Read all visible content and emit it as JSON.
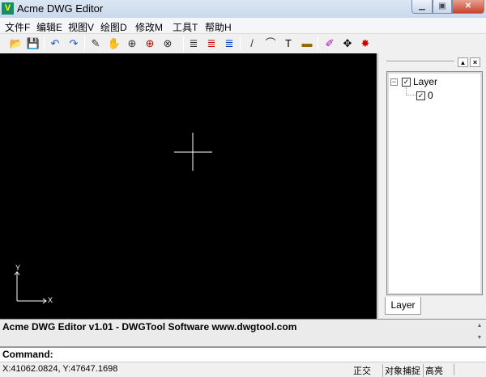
{
  "title": "Acme DWG Editor",
  "app_icon": "V",
  "menu": [
    "文件F",
    "编辑E",
    "视图V",
    "绘图D",
    "修改M",
    "工具T",
    "帮助H"
  ],
  "toolbar": [
    {
      "name": "open-icon",
      "glyph": "📂"
    },
    {
      "name": "save-icon",
      "glyph": "💾"
    },
    {
      "name": "undo-icon",
      "glyph": "↶"
    },
    {
      "name": "redo-icon",
      "glyph": "↷"
    },
    {
      "name": "pencil-icon",
      "glyph": "✎"
    },
    {
      "name": "pan-hand-icon",
      "glyph": "✋"
    },
    {
      "name": "zoom-window-icon",
      "glyph": "⊕"
    },
    {
      "name": "zoom-center-icon",
      "glyph": "⊕"
    },
    {
      "name": "zoom-extents-icon",
      "glyph": "⊗"
    },
    {
      "name": "layers-icon",
      "glyph": "≣"
    },
    {
      "name": "layer-new-icon",
      "glyph": "≣"
    },
    {
      "name": "layer-color-icon",
      "glyph": "≣"
    },
    {
      "name": "line-icon",
      "glyph": "/"
    },
    {
      "name": "arc-icon",
      "glyph": "⌒"
    },
    {
      "name": "text-icon",
      "glyph": "T"
    },
    {
      "name": "dimension-icon",
      "glyph": "▬"
    },
    {
      "name": "eraser-icon",
      "glyph": "✐"
    },
    {
      "name": "move-icon",
      "glyph": "✥"
    },
    {
      "name": "explode-icon",
      "glyph": "✸"
    }
  ],
  "panel": {
    "tree_root": "Layer",
    "tree_child": "0",
    "tab": "Layer",
    "root_expander": "−",
    "check": "✓"
  },
  "axes": {
    "x": "X",
    "y": "Y"
  },
  "output_text": "Acme DWG Editor v1.01 - DWGTool Software www.dwgtool.com",
  "command_label": "Command:",
  "status": {
    "coords": "X:41062.0824, Y:47647.1698",
    "ortho": "正交",
    "osnap": "对象捕捉",
    "highlight": "高亮"
  }
}
